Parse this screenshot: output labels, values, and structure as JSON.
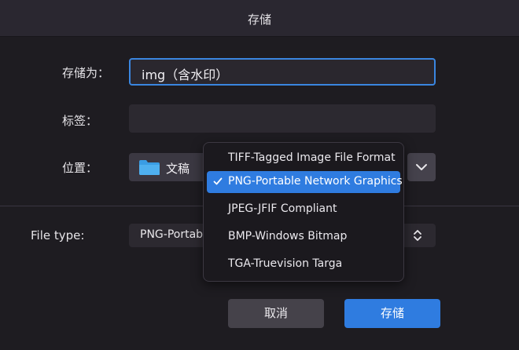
{
  "dialog": {
    "title": "存储",
    "fields": {
      "save_as_label": "存储为：",
      "save_as_value": "img（含水印）",
      "tags_label": "标签：",
      "tags_value": "",
      "location_label": "位置：",
      "location_value": "文稿",
      "file_type_label": "File type:",
      "file_type_value": "PNG-Portabl"
    },
    "format_menu": {
      "items": [
        {
          "label": "TIFF-Tagged Image File Format",
          "selected": false
        },
        {
          "label": "PNG-Portable Network Graphics",
          "selected": true
        },
        {
          "label": "JPEG-JFIF Compliant",
          "selected": false
        },
        {
          "label": "BMP-Windows Bitmap",
          "selected": false
        },
        {
          "label": "TGA-Truevision Targa",
          "selected": false
        }
      ]
    },
    "buttons": {
      "cancel": "取消",
      "save": "存储"
    },
    "colors": {
      "accent": "#2f7ce0",
      "folder": "#3a9de4",
      "background": "#1e1c21"
    },
    "icons": [
      "folder-icon",
      "chevron-down-icon",
      "up-down-arrows-icon",
      "checkmark-icon"
    ]
  }
}
